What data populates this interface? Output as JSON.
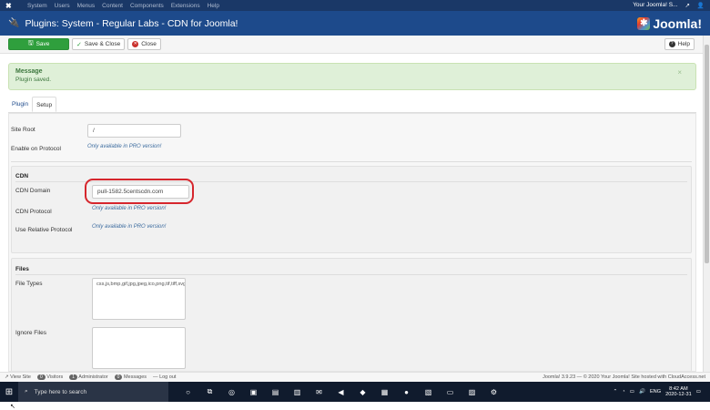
{
  "topbar": {
    "menu": [
      "System",
      "Users",
      "Menus",
      "Content",
      "Components",
      "Extensions",
      "Help"
    ],
    "site_name": "Your Joomla! S...",
    "icons": [
      "joomla-x-icon",
      "external-link-icon",
      "user-icon"
    ]
  },
  "header": {
    "title": "Plugins: System - Regular Labs - CDN for Joomla!",
    "brand": "Joomla!"
  },
  "toolbar": {
    "save_label": "Save",
    "save_close_label": "Save & Close",
    "close_label": "Close",
    "help_label": "Help"
  },
  "message": {
    "title": "Message",
    "text": "Plugin saved.",
    "close": "×"
  },
  "tabs": [
    {
      "label": "Plugin",
      "active": false
    },
    {
      "label": "Setup",
      "active": true
    }
  ],
  "fields": {
    "site_root_label": "Site Root",
    "site_root_value": "/",
    "enable_protocol_label": "Enable on Protocol",
    "pro_note": "Only available in PRO version!",
    "cdn_section": "CDN",
    "cdn_domain_label": "CDN Domain",
    "cdn_domain_value": "pull-1582.5centscdn.com",
    "cdn_protocol_label": "CDN Protocol",
    "relative_protocol_label": "Use Relative Protocol",
    "files_section": "Files",
    "file_types_label": "File Types",
    "file_types_value": "css,js,bmp,gif,jpg,jpeg,ico,png,tif,tiff,svg,doc,docx,odt,pdf,rtf,txt",
    "ignore_files_label": "Ignore Files",
    "ignore_files_value": ""
  },
  "status_bar": {
    "view_site": "View Site",
    "visitors_count": "0",
    "visitors_label": "Visitors",
    "administrator_count": "1",
    "administrator_label": "Administrator",
    "messages_count": "0",
    "messages_label": "Messages",
    "logout": "Log out",
    "footer_text": "Joomla! 3.9.23 — © 2020 Your Joomla! Site hosted with CloudAccess.net"
  },
  "taskbar": {
    "search_placeholder": "Type here to search",
    "language": "ENG",
    "time": "8:42 AM",
    "date": "2020-12-31"
  },
  "colors": {
    "header_blue": "#1d4a8b",
    "topbar_blue": "#1a3867",
    "save_green": "#2f9f3d",
    "success_bg": "#dff0d8",
    "annotation_red": "#d6262d"
  }
}
